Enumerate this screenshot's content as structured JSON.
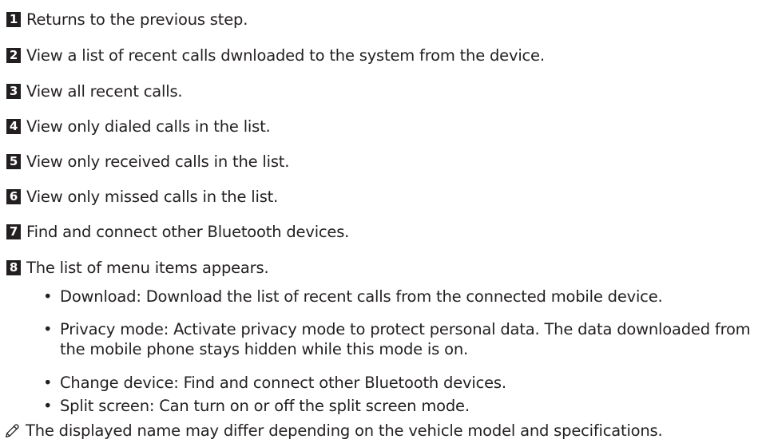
{
  "steps": [
    {
      "num": "1",
      "text": "Returns to the previous step."
    },
    {
      "num": "2",
      "text": "View a list of recent calls dwnloaded to the system from the device."
    },
    {
      "num": "3",
      "text": "View all recent calls."
    },
    {
      "num": "4",
      "text": "View only dialed calls in the list."
    },
    {
      "num": "5",
      "text": "View only received calls in the list."
    },
    {
      "num": "6",
      "text": "View only missed calls in the list."
    },
    {
      "num": "7",
      "text": "Find and connect other Bluetooth devices."
    },
    {
      "num": "8",
      "text": "The list of menu items appears."
    }
  ],
  "menu_items": [
    {
      "bullet": "•",
      "text": "Download: Download the list of recent calls from the connected mobile device."
    },
    {
      "bullet": "•",
      "text": "Privacy mode: Activate privacy mode to protect personal data. The data downloaded from the mobile phone stays hidden while this mode is on."
    },
    {
      "bullet": "•",
      "text": "Change device: Find and connect other Bluetooth devices."
    },
    {
      "bullet": "•",
      "text": "Split screen: Can turn on or off the split screen mode."
    }
  ],
  "note": {
    "icon": "pencil-icon",
    "text": "The displayed name may differ depending on the vehicle model and specifications."
  }
}
